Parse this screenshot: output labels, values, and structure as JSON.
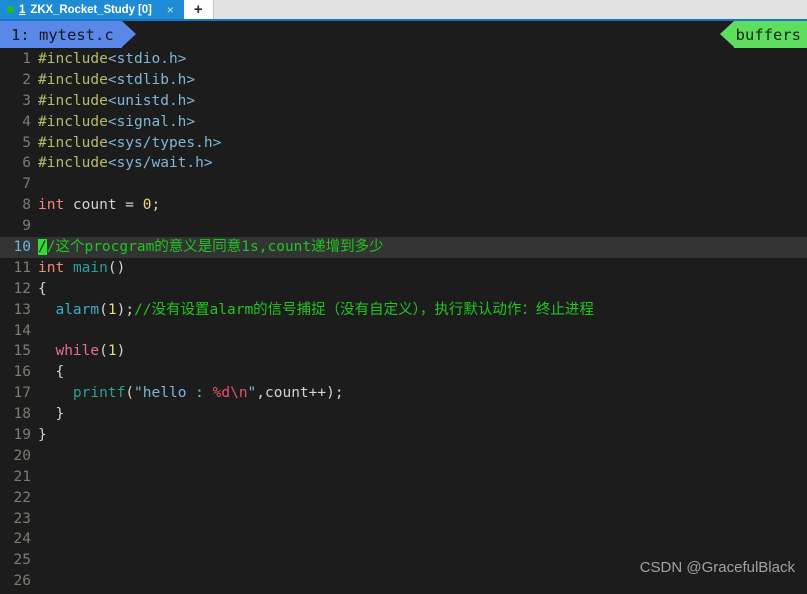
{
  "window": {
    "tabbar": {
      "tabs": [
        {
          "status_dot": "session-active-dot",
          "number": "1",
          "title": "ZKX_Rocket_Study [0]",
          "close_label": "×"
        }
      ],
      "new_tab_label": "+"
    },
    "colors": {
      "tab_active": "#1e8bd4",
      "tabbar_bg": "#e2e2e2",
      "accent_underline": "#1177c4",
      "editor_bg": "#1c1c1c",
      "buffer_tab": "#5a88e8",
      "buffers_label": "#5fdd5f",
      "cursor": "#2ee02e",
      "current_line_bg": "#333333"
    }
  },
  "bufferline": {
    "active_buffer": "1: mytest.c",
    "right_label": "buffers"
  },
  "editor": {
    "filename": "mytest.c",
    "current_line": 10,
    "cursor_column": 1,
    "lines": [
      {
        "num": "1",
        "tokens": [
          {
            "t": "#include",
            "c": "c-pre"
          },
          {
            "t": "<stdio.h>",
            "c": "c-hdr"
          }
        ]
      },
      {
        "num": "2",
        "tokens": [
          {
            "t": "#include",
            "c": "c-pre"
          },
          {
            "t": "<stdlib.h>",
            "c": "c-hdr"
          }
        ]
      },
      {
        "num": "3",
        "tokens": [
          {
            "t": "#include",
            "c": "c-pre"
          },
          {
            "t": "<unistd.h>",
            "c": "c-hdr"
          }
        ]
      },
      {
        "num": "4",
        "tokens": [
          {
            "t": "#include",
            "c": "c-pre"
          },
          {
            "t": "<signal.h>",
            "c": "c-hdr"
          }
        ]
      },
      {
        "num": "5",
        "tokens": [
          {
            "t": "#include",
            "c": "c-pre"
          },
          {
            "t": "<sys/types.h>",
            "c": "c-hdr"
          }
        ]
      },
      {
        "num": "6",
        "tokens": [
          {
            "t": "#include",
            "c": "c-pre"
          },
          {
            "t": "<sys/wait.h>",
            "c": "c-hdr"
          }
        ]
      },
      {
        "num": "7",
        "tokens": []
      },
      {
        "num": "8",
        "tokens": [
          {
            "t": "int",
            "c": "c-kw"
          },
          {
            "t": " count = ",
            "c": "c-plain"
          },
          {
            "t": "0",
            "c": "c-num"
          },
          {
            "t": ";",
            "c": "c-plain"
          }
        ]
      },
      {
        "num": "9",
        "tokens": []
      },
      {
        "num": "10",
        "current": true,
        "tokens": [
          {
            "t": "/",
            "c": "c-cmt cursor-blk"
          },
          {
            "t": "/这个procgram的意义是同意1s,count递增到多少",
            "c": "c-cmt"
          }
        ]
      },
      {
        "num": "11",
        "tokens": [
          {
            "t": "int",
            "c": "c-kw"
          },
          {
            "t": " ",
            "c": "c-plain"
          },
          {
            "t": "main",
            "c": "c-fn"
          },
          {
            "t": "()",
            "c": "c-plain"
          }
        ]
      },
      {
        "num": "12",
        "tokens": [
          {
            "t": "{",
            "c": "c-plain"
          }
        ]
      },
      {
        "num": "13",
        "tokens": [
          {
            "t": "  ",
            "c": "c-plain"
          },
          {
            "t": "alarm",
            "c": "c-fn2"
          },
          {
            "t": "(",
            "c": "c-plain"
          },
          {
            "t": "1",
            "c": "c-num"
          },
          {
            "t": ");",
            "c": "c-plain"
          },
          {
            "t": "//没有设置alarm的信号捕捉（没有自定义），执行默认动作：终止进程",
            "c": "c-cmt"
          }
        ]
      },
      {
        "num": "14",
        "tokens": []
      },
      {
        "num": "15",
        "tokens": [
          {
            "t": "  ",
            "c": "c-plain"
          },
          {
            "t": "while",
            "c": "c-ctrl"
          },
          {
            "t": "(",
            "c": "c-plain"
          },
          {
            "t": "1",
            "c": "c-num"
          },
          {
            "t": ")",
            "c": "c-plain"
          }
        ]
      },
      {
        "num": "16",
        "tokens": [
          {
            "t": "  {",
            "c": "c-plain"
          }
        ]
      },
      {
        "num": "17",
        "tokens": [
          {
            "t": "    ",
            "c": "c-plain"
          },
          {
            "t": "printf",
            "c": "c-fn"
          },
          {
            "t": "(",
            "c": "c-plain"
          },
          {
            "t": "\"hello : ",
            "c": "c-str"
          },
          {
            "t": "%d\\n",
            "c": "c-esc"
          },
          {
            "t": "\"",
            "c": "c-str"
          },
          {
            "t": ",count++);",
            "c": "c-plain"
          }
        ]
      },
      {
        "num": "18",
        "tokens": [
          {
            "t": "  }",
            "c": "c-plain"
          }
        ]
      },
      {
        "num": "19",
        "tokens": [
          {
            "t": "}",
            "c": "c-plain"
          }
        ]
      },
      {
        "num": "20",
        "tokens": []
      },
      {
        "num": "21",
        "tokens": []
      },
      {
        "num": "22",
        "tokens": []
      },
      {
        "num": "23",
        "tokens": []
      },
      {
        "num": "24",
        "tokens": []
      },
      {
        "num": "25",
        "tokens": []
      },
      {
        "num": "26",
        "tokens": []
      }
    ]
  },
  "watermark": "CSDN @GracefulBlack"
}
